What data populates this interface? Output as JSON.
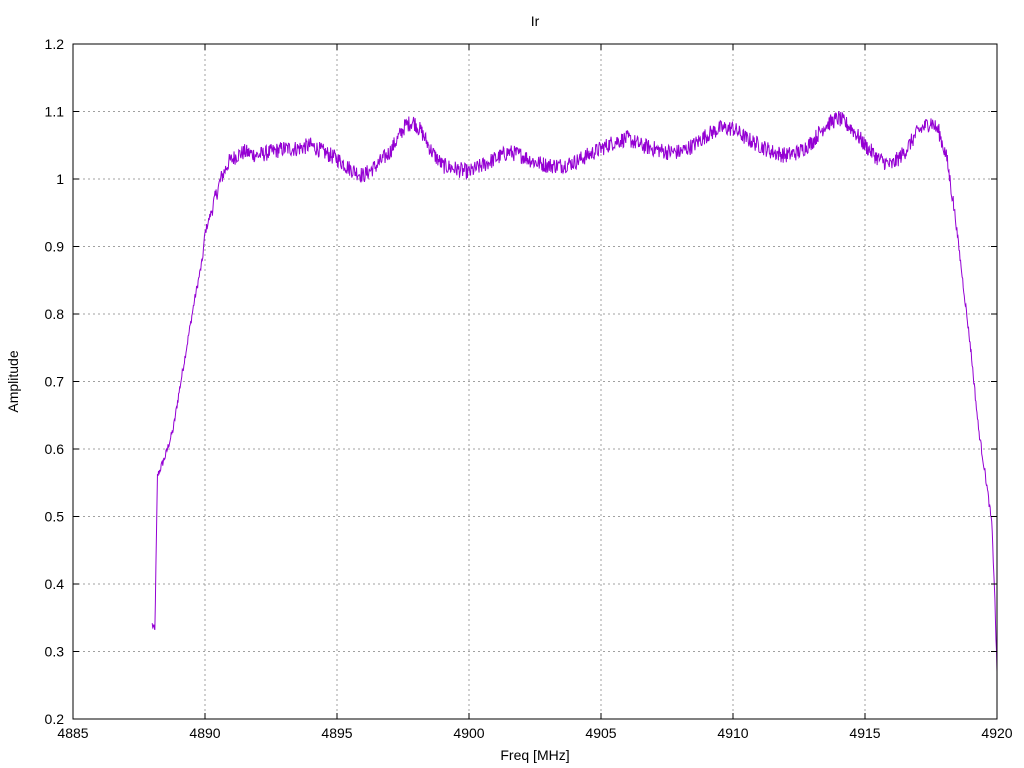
{
  "chart_data": {
    "type": "line",
    "title": "Ir",
    "xlabel": "Freq [MHz]",
    "ylabel": "Amplitude",
    "xlim": [
      4885,
      4920
    ],
    "ylim": [
      0.2,
      1.2
    ],
    "xticks": [
      4885,
      4890,
      4895,
      4900,
      4905,
      4910,
      4915,
      4920
    ],
    "yticks": [
      0.2,
      0.3,
      0.4,
      0.5,
      0.6,
      0.7,
      0.8,
      0.9,
      1,
      1.1,
      1.2
    ],
    "xtick_labels": [
      "4885",
      "4890",
      "4895",
      "4900",
      "4905",
      "4910",
      "4915",
      "4920"
    ],
    "ytick_labels": [
      "0.2",
      "0.3",
      "0.4",
      "0.5",
      "0.6",
      "0.7",
      "0.8",
      "0.9",
      "1",
      "1.1",
      "1.2"
    ],
    "grid": true,
    "legend": "none",
    "line_color": "#9400d3",
    "series": [
      {
        "x": [
          4888.0,
          4888.1,
          4888.2,
          4888.5,
          4888.8,
          4889.0,
          4889.3,
          4889.6,
          4889.9,
          4890.0,
          4890.3,
          4890.6,
          4890.9,
          4891.2,
          4891.5,
          4892.0,
          4892.5,
          4893.0,
          4893.5,
          4894.0,
          4894.5,
          4895.0,
          4895.5,
          4896.0,
          4896.5,
          4897.0,
          4897.3,
          4897.6,
          4897.9,
          4898.2,
          4898.6,
          4899.0,
          4899.5,
          4900.0,
          4900.5,
          4901.0,
          4901.5,
          4902.0,
          4902.5,
          4903.0,
          4903.5,
          4904.0,
          4904.5,
          4905.0,
          4905.5,
          4906.0,
          4906.5,
          4907.0,
          4907.5,
          4908.0,
          4908.5,
          4909.0,
          4909.5,
          4910.0,
          4910.5,
          4911.0,
          4911.5,
          4912.0,
          4912.5,
          4913.0,
          4913.5,
          4914.0,
          4914.5,
          4915.0,
          4915.5,
          4916.0,
          4916.5,
          4917.0,
          4917.5,
          4917.8,
          4918.1,
          4918.4,
          4918.7,
          4919.0,
          4919.3,
          4919.6,
          4919.8,
          4919.9,
          4920.0
        ],
        "y": [
          0.34,
          0.33,
          0.56,
          0.59,
          0.63,
          0.68,
          0.75,
          0.82,
          0.88,
          0.92,
          0.96,
          1.0,
          1.025,
          1.035,
          1.04,
          1.035,
          1.04,
          1.045,
          1.045,
          1.05,
          1.04,
          1.03,
          1.015,
          1.005,
          1.02,
          1.04,
          1.06,
          1.08,
          1.085,
          1.07,
          1.04,
          1.02,
          1.015,
          1.01,
          1.02,
          1.03,
          1.04,
          1.035,
          1.025,
          1.02,
          1.02,
          1.025,
          1.035,
          1.045,
          1.055,
          1.06,
          1.05,
          1.045,
          1.04,
          1.04,
          1.05,
          1.065,
          1.075,
          1.075,
          1.06,
          1.05,
          1.04,
          1.035,
          1.04,
          1.055,
          1.08,
          1.09,
          1.075,
          1.05,
          1.03,
          1.02,
          1.04,
          1.07,
          1.085,
          1.07,
          1.03,
          0.95,
          0.85,
          0.75,
          0.63,
          0.55,
          0.49,
          0.4,
          0.27
        ]
      }
    ]
  }
}
